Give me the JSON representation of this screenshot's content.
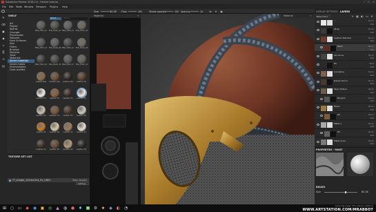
{
  "window": {
    "title": "Substance Painter 2018.2.0 - Helmet tutorial"
  },
  "menu": [
    "File",
    "Edit",
    "Mode",
    "Window",
    "Viewport",
    "Plugins",
    "Help"
  ],
  "toolbar": {
    "size_label": "Size",
    "size_value": "80.38",
    "flow_label": "Flow",
    "flow_value": "100",
    "stroke_label": "Stroke opacity",
    "stroke_value": "100",
    "spacing_label": "Spacing",
    "spacing_value": "10"
  },
  "shelf": {
    "title": "SHELF",
    "search_placeholder": "Search...",
    "filter_chip": "Smart ...",
    "categories": [
      "Art",
      "Project",
      "Alphas",
      "Grunges",
      "Procedurals",
      "Textures",
      "Hard Surfaces",
      "Skin",
      "Filters",
      "Brushes",
      "Particles",
      "Tools",
      "Materials",
      "Smart materials",
      "Smart masks",
      "Environments",
      "Color profiles"
    ],
    "selected_category": "Smart materials",
    "items": [
      {
        "label": "BSG_Helm_01",
        "color": "#5a5a55"
      },
      {
        "label": "BSG_Helm_02",
        "color": "#4e4e4a"
      },
      {
        "label": "BSG_Helm_03",
        "color": "#5f6060"
      },
      {
        "label": "BSG_Helm_04",
        "color": "#6a665e"
      },
      {
        "label": "BSG_Helm_05",
        "color": "#525250"
      },
      {
        "label": "BSG_Helm_06",
        "color": "#5c5c5a"
      },
      {
        "label": "BSG_Helm_07",
        "color": "#48484a"
      },
      {
        "label": "BSG_Helm_08",
        "color": "#6f6a60"
      },
      {
        "label": "BSG_Helm_09",
        "color": "#3c3c3c"
      },
      {
        "label": "BSG_Helm_10",
        "color": "#4a4844"
      },
      {
        "label": "BSG_Helm_11",
        "color": "#585858"
      },
      {
        "label": "BSG_Helm_12",
        "color": "#65605a"
      },
      {
        "label": "Leather Bas",
        "color": "#8a6a48"
      },
      {
        "label": "Leather Cas",
        "color": "#6d4f35"
      },
      {
        "label": "Leather Dar",
        "color": "#2e2622"
      },
      {
        "label": "Leather Fin",
        "color": "#5a3f2c"
      },
      {
        "label": "Leather Fin",
        "color": "#f0ece6"
      },
      {
        "label": "Leather Fin",
        "color": "#8c5c3e"
      },
      {
        "label": "Leather Fin",
        "color": "#3a2a22"
      },
      {
        "label": "Leather Fin",
        "color": "#efe9e0"
      },
      {
        "label": "Leather Fro",
        "color": "#c9c0b4"
      },
      {
        "label": "Leather Fro",
        "color": "#7a5436"
      },
      {
        "label": "Leather Fin",
        "color": "#4a3325"
      },
      {
        "label": "Leather Ro",
        "color": "#cfc8bd"
      },
      {
        "label": "Leather Ta",
        "color": "#c47a2a"
      },
      {
        "label": "Leather Sal",
        "color": "#d6c9a6"
      },
      {
        "label": "Leather Sh",
        "color": "#a07a5a"
      },
      {
        "label": "Leather Ro",
        "color": "#e6dfd4"
      },
      {
        "label": "Leather Su",
        "color": "#3d2e26"
      },
      {
        "label": "Leather Sh",
        "color": "#6a4a32"
      },
      {
        "label": "Leather Sol",
        "color": "#b09a7a"
      },
      {
        "label": "Leather Tw",
        "color": "#2a2420"
      }
    ]
  },
  "viewport": {
    "left_mode": "Material",
    "right_mode": "Material"
  },
  "texture_set": {
    "title": "TEXTURE SET LIST",
    "settings_label": "Settings",
    "item_name": "TT_shader_1024x1024_SV_UDIO",
    "shader": "Main shader"
  },
  "right": {
    "tab1": "DISPLAY SETTINGS",
    "tab2": "LAYERS",
    "channel": "Base Color",
    "layers": [
      {
        "name": "...",
        "blend": "Norm",
        "opacity": "100",
        "color": "#e8e8e8"
      },
      {
        "name": "Strap",
        "blend": "Norm",
        "opacity": "100",
        "color": "#3a3a3a"
      },
      {
        "name": "Leather Stitched",
        "blend": "Norm",
        "opacity": "100",
        "color": "#6d3a2a"
      },
      {
        "name": "Paint",
        "blend": "Norm",
        "opacity": "100",
        "color": "#5b2a22"
      },
      {
        "name": "AO Curve",
        "blend": "Norm",
        "opacity": "100",
        "color": "#444444"
      },
      {
        "name": "Fill",
        "blend": "Mult",
        "opacity": "100",
        "color": "#2a2a2a"
      },
      {
        "name": "Curvature",
        "blend": "Norm",
        "opacity": "100",
        "color": "#806050"
      },
      {
        "name": "Darker Touch",
        "blend": "Norm",
        "opacity": "100",
        "color": "#4a3830"
      },
      {
        "name": "Stain Hollow",
        "blend": "Norm",
        "opacity": "100",
        "color": "#6a5a4a"
      },
      {
        "name": "Blur/pin",
        "blend": "Norm",
        "opacity": "100",
        "color": "#555555"
      },
      {
        "name": "Brass",
        "blend": "Norm",
        "opacity": "100",
        "color": "#9a7a3a"
      },
      {
        "name": "Fill",
        "blend": "Norm",
        "opacity": "100",
        "color": "#7a5a3a"
      },
      {
        "name": "Metal 1",
        "blend": "Norm",
        "opacity": "100",
        "color": "#a8a8a8"
      },
      {
        "name": "Fill",
        "blend": "Norm",
        "opacity": "100",
        "color": "#606060"
      },
      {
        "name": "Metal inner",
        "blend": "Norm",
        "opacity": "100",
        "color": "#7a7a7a"
      }
    ],
    "props_title": "PROPERTIES - PAINT",
    "brush_label": "BRUSH",
    "size_label": "Size",
    "size_value": "80.38"
  },
  "status": {
    "left": "",
    "right": "Cache disk usage: 37% | Version: 2018.2.0"
  },
  "watermark": "WWW.ARTSTATION.COM/MRABBOT",
  "colors": {
    "accent": "#3a5f85",
    "leather": "#7a3a2a",
    "brass": "#b88a3a"
  }
}
